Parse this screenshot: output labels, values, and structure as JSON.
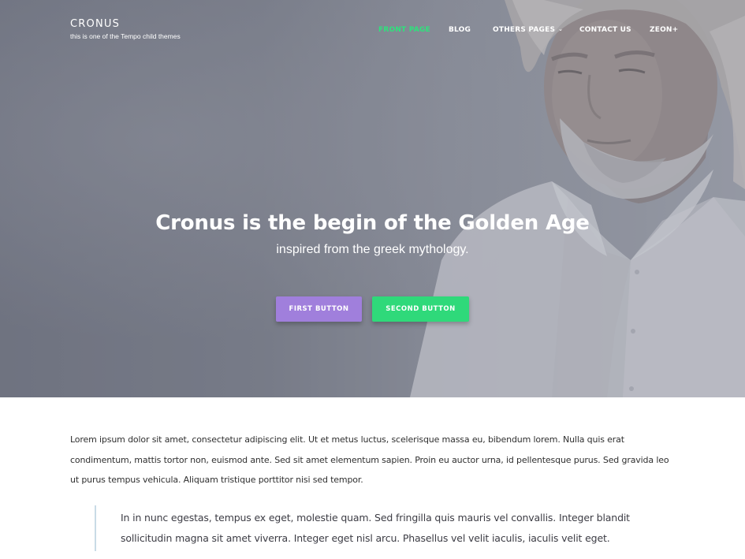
{
  "site": {
    "title": "CRONUS",
    "tagline": "this is one of the Tempo child themes"
  },
  "nav": {
    "items": [
      {
        "label": "FRONT PAGE",
        "active": true
      },
      {
        "label": "BLOG",
        "active": false
      },
      {
        "label": "OTHERS PAGES",
        "active": false,
        "has_dropdown": true
      },
      {
        "label": "CONTACT US",
        "active": false
      },
      {
        "label": "ZEON+",
        "active": false
      }
    ],
    "dropdown_icon": "chevron-down-icon",
    "active_color": "#2ee27c"
  },
  "hero": {
    "title": "Cronus is the begin of the Golden Age",
    "subtitle": "inspired from the greek mythology.",
    "first_button": "FIRST BUTTON",
    "second_button": "SECOND BUTTON",
    "first_button_color": "#a07fdc",
    "second_button_color": "#2fd97a"
  },
  "content": {
    "paragraph": "Lorem ipsum dolor sit amet, consectetur adipiscing elit. Ut et metus luctus, scelerisque massa eu, bibendum lorem. Nulla quis erat condimentum, mattis tortor non, euismod ante. Sed sit amet elementum sapien. Proin eu auctor urna, id pellentesque purus. Sed gravida leo ut purus tempus vehicula. Aliquam tristique porttitor nisi sed tempor.",
    "blockquote": "In in nunc egestas, tempus ex eget, molestie quam. Sed fringilla quis mauris vel convallis. Integer blandit sollicitudin magna sit amet viverra. Integer eget nisl arcu. Phasellus vel velit iaculis, iaculis velit eget."
  }
}
